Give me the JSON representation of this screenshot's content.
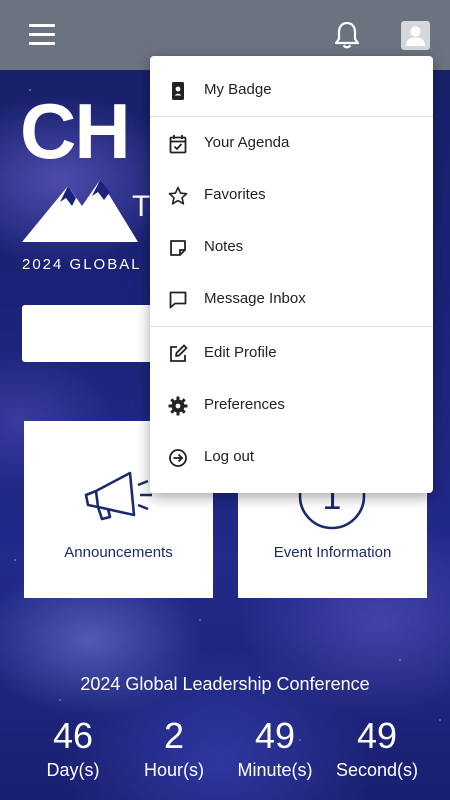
{
  "header": {
    "menu_icon": "hamburger-icon",
    "notification_icon": "bell-icon",
    "profile_icon": "user-avatar-icon"
  },
  "hero": {
    "logo_text": "CH",
    "logo_subtitle": "2024 GLOBAL"
  },
  "tiles": [
    {
      "label": "Announcements",
      "icon": "megaphone-icon"
    },
    {
      "label": "Event Information",
      "icon": "info-number-icon",
      "icon_text": "1"
    }
  ],
  "footer": {
    "title": "2024 Global Leadership Conference",
    "countdown": [
      {
        "value": "46",
        "unit": "Day(s)"
      },
      {
        "value": "2",
        "unit": "Hour(s)"
      },
      {
        "value": "49",
        "unit": "Minute(s)"
      },
      {
        "value": "49",
        "unit": "Second(s)"
      }
    ]
  },
  "dropdown_menu": {
    "items": [
      {
        "label": "My Badge",
        "icon": "badge-icon"
      },
      {
        "label": "Your Agenda",
        "icon": "calendar-check-icon"
      },
      {
        "label": "Favorites",
        "icon": "star-icon"
      },
      {
        "label": "Notes",
        "icon": "note-icon"
      },
      {
        "label": "Message Inbox",
        "icon": "message-icon"
      },
      {
        "label": "Edit Profile",
        "icon": "edit-icon"
      },
      {
        "label": "Preferences",
        "icon": "gear-icon"
      },
      {
        "label": "Log out",
        "icon": "logout-icon"
      }
    ]
  },
  "colors": {
    "header_bg": "#6b7380",
    "tile_text": "#1c2a6e",
    "page_bg": "#1b237a"
  }
}
